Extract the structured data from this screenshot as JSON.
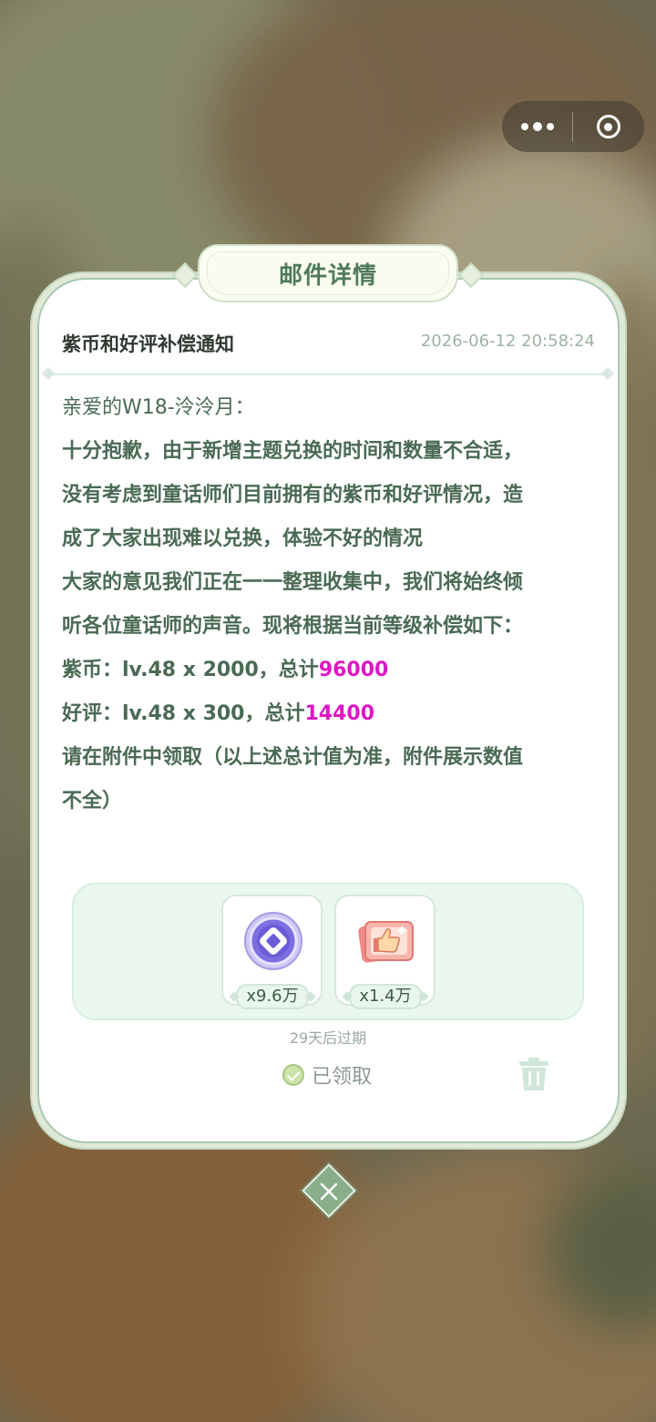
{
  "capsule": {
    "more_icon": "more-dots-icon",
    "target_icon": "target-icon"
  },
  "mail": {
    "panel_title": "邮件详情",
    "subject": "紫币和好评补偿通知",
    "timestamp": "2026-06-12 20:58:24",
    "greeting": "亲爱的W18-泠泠月：",
    "lines": [
      "十分抱歉，由于新增主题兑换的时间和数量不合适，",
      "没有考虑到童话师们目前拥有的紫币和好评情况，造",
      "成了大家出现难以兑换，体验不好的情况",
      "大家的意见我们正在一一整理收集中，我们将始终倾",
      "听各位童话师的声音。现将根据当前等级补偿如下："
    ],
    "coin_line": {
      "prefix": "紫币：lv.48 x 2000，总计",
      "total": "96000"
    },
    "praise_line": {
      "prefix": "好评：lv.48 x 300，总计",
      "total": "14400"
    },
    "note_lines": [
      "请在附件中领取（以上述总计值为准，附件展示数值",
      "不全）"
    ],
    "attachments": [
      {
        "icon": "purple-coin-icon",
        "quantity": "x9.6万"
      },
      {
        "icon": "thumbs-up-card-icon",
        "quantity": "x1.4万"
      }
    ],
    "expire_text": "29天后过期",
    "received_label": "已领取",
    "highlight_color": "#e016c4"
  },
  "close_icon": "close-icon",
  "trash_icon": "trash-icon"
}
